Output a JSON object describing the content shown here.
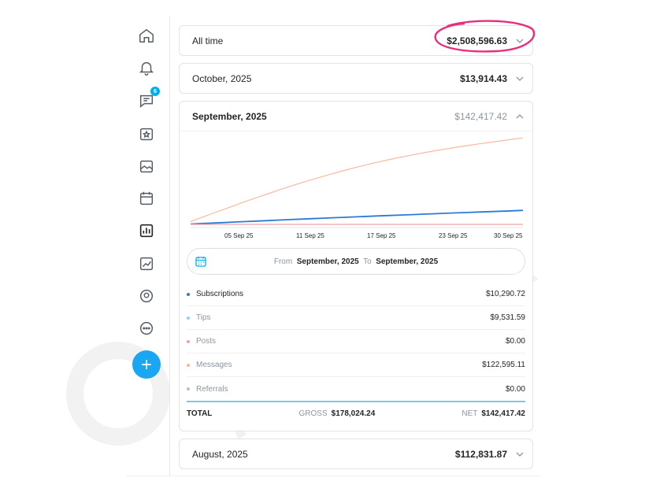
{
  "watermark": {
    "text": "MOVELLA"
  },
  "sidebar": {
    "icons": [
      "home-icon",
      "bell-icon",
      "messages-icon",
      "collections-icon",
      "vault-icon",
      "calendar-icon",
      "statistics-icon",
      "analytics-icon",
      "profile-icon",
      "more-icon"
    ],
    "messages_badge": "6"
  },
  "rows": {
    "all_time": {
      "label": "All time",
      "amount": "$2,508,596.63"
    },
    "october": {
      "label": "October, 2025",
      "amount": "$13,914.43"
    },
    "august": {
      "label": "August, 2025",
      "amount": "$112,831.87"
    }
  },
  "september": {
    "title": "September, 2025",
    "amount": "$142,417.42",
    "date_range": {
      "from_label": "From",
      "from": "September, 2025",
      "to_label": "To",
      "to": "September, 2025"
    },
    "breakdown": [
      {
        "label": "Subscriptions",
        "value": "$10,290.72",
        "color": "#2b7bd6"
      },
      {
        "label": "Tips",
        "value": "$9,531.59",
        "color": "#8fd3ee"
      },
      {
        "label": "Posts",
        "value": "$0.00",
        "color": "#f2a0a8"
      },
      {
        "label": "Messages",
        "value": "$122,595.11",
        "color": "#f7b9a0"
      },
      {
        "label": "Referrals",
        "value": "$0.00",
        "color": "#b9bfc6"
      }
    ],
    "total": {
      "label": "TOTAL",
      "gross_label": "GROSS",
      "gross": "$178,024.24",
      "net_label": "NET",
      "net": "$142,417.42"
    }
  },
  "chart_data": {
    "type": "line",
    "x_ticks": [
      "05 Sep 25",
      "11 Sep 25",
      "17 Sep 25",
      "23 Sep 25",
      "30 Sep 25"
    ],
    "x": [
      1,
      30
    ],
    "series": [
      {
        "values": [
          4000,
          122595
        ],
        "color": "#f7b9a0"
      },
      {
        "values": [
          500,
          19822
        ],
        "color": "#2b7bd6"
      },
      {
        "values": [
          0,
          0
        ],
        "color": "#f2a0a8"
      }
    ],
    "ylim": [
      0,
      125000
    ]
  },
  "colors": {
    "accent": "#00aff0",
    "fab": "#1aa6f0",
    "circle_annotation": "#e8307a"
  }
}
